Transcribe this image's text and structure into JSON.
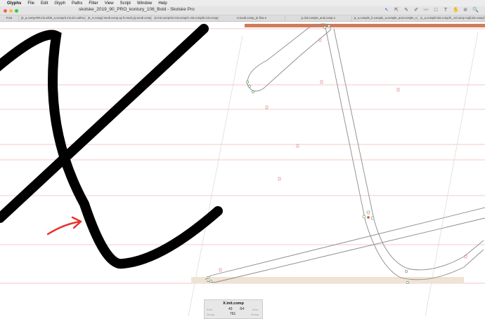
{
  "menubar": {
    "apple": "",
    "items": [
      "Glyphs",
      "File",
      "Edit",
      "Glyph",
      "Paths",
      "Filter",
      "View",
      "Script",
      "Window",
      "Help"
    ]
  },
  "window": {
    "title": "skolske_2019_90_PRO_kontury_106_Bold - Skolske Pro"
  },
  "toolbar": {
    "icons": [
      "select-tool-icon",
      "select-all-tool-icon",
      "draw-tool-icon",
      "pencil-tool-icon",
      "brush-tool-icon",
      "primitive-tool-icon",
      "text-tool-icon",
      "hand-tool-icon",
      "measure-tool-icon",
      "zoom-tool-icon"
    ],
    "glyphs": [
      "↖",
      "⇱",
      "✎",
      "✐",
      "〰",
      "□",
      "T",
      "✋",
      "⊘",
      "🔍"
    ]
  },
  "tabs": [
    "Font",
    "jX_a.comp-RR.init.1/5/5_a.comp/X.init.2/J.cal/Ha.init",
    "jX_n.compj/.medi.comp.ay ft.medi.y/y.medi.comp.t/y.s...",
    "jX.init.comp/X2.init.comp/C.init.comp/E.init.comp/O.init...",
    "H.medi.comp_jX.fina-e",
    "jx.init.comple_and.comp-x",
    "jx_a.comple_b.comple_a.comple_and.comple_n.comp...",
    "jx_a.compl/t.init.comp/h_.ivl.comp Aajil.init.comp/x..."
  ],
  "info_panel": {
    "glyph_name": "X.init.comp",
    "labels": {
      "kern_left": "Kern",
      "kern_right": "Kern",
      "group_left": "Group",
      "group_right": "Group"
    },
    "lsb": "43",
    "rsb": "-54",
    "width": "761"
  },
  "colors": {
    "accent": "#2b6de0",
    "arrow": "#e8302a",
    "guide": "#f3b8b8",
    "metric_bar": "#c8643c",
    "stroke": "#000000"
  }
}
